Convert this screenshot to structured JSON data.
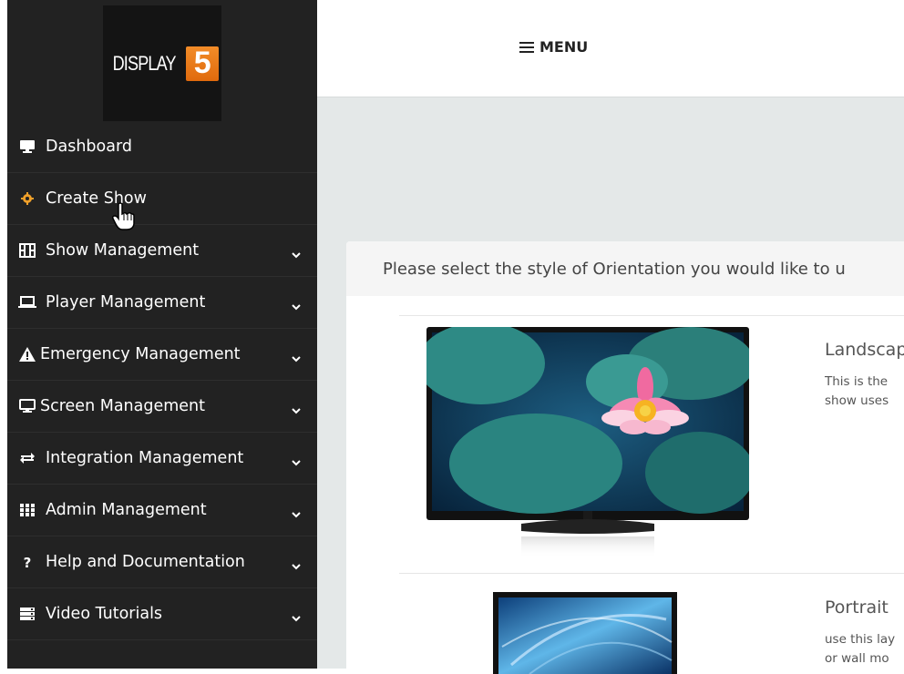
{
  "brand": {
    "logo_text": "DISPLAY",
    "logo_number": "5",
    "accent": "#ee7d1e"
  },
  "header": {
    "menu_label": "MENU",
    "menu_icon": "hamburger-icon"
  },
  "sidebar": {
    "items": [
      {
        "label": "Dashboard",
        "icon": "monitor-icon",
        "has_chevron": false
      },
      {
        "label": "Create Show",
        "icon": "gear-icon",
        "icon_color": "#f0a02a",
        "has_chevron": false
      },
      {
        "label": "Show Management",
        "icon": "film-icon",
        "has_chevron": true
      },
      {
        "label": "Player Management",
        "icon": "laptop-icon",
        "has_chevron": true
      },
      {
        "label": "Emergency Management",
        "icon": "warning-icon",
        "has_chevron": true
      },
      {
        "label": "Screen Management",
        "icon": "monitor-icon",
        "has_chevron": true
      },
      {
        "label": "Integration Management",
        "icon": "exchange-icon",
        "has_chevron": true
      },
      {
        "label": "Admin Management",
        "icon": "grid-icon",
        "has_chevron": true
      },
      {
        "label": "Help and Documentation",
        "icon": "question-icon",
        "has_chevron": true
      },
      {
        "label": "Video Tutorials",
        "icon": "server-icon",
        "has_chevron": true
      }
    ]
  },
  "main": {
    "prompt": "Please select the style of Orientation you would like to u",
    "options": [
      {
        "title": "Landscap",
        "desc_line1": "This is the",
        "desc_line2": "show uses"
      },
      {
        "title": "Portrait",
        "desc_line1": "use this lay",
        "desc_line2": "or wall mo"
      }
    ]
  }
}
